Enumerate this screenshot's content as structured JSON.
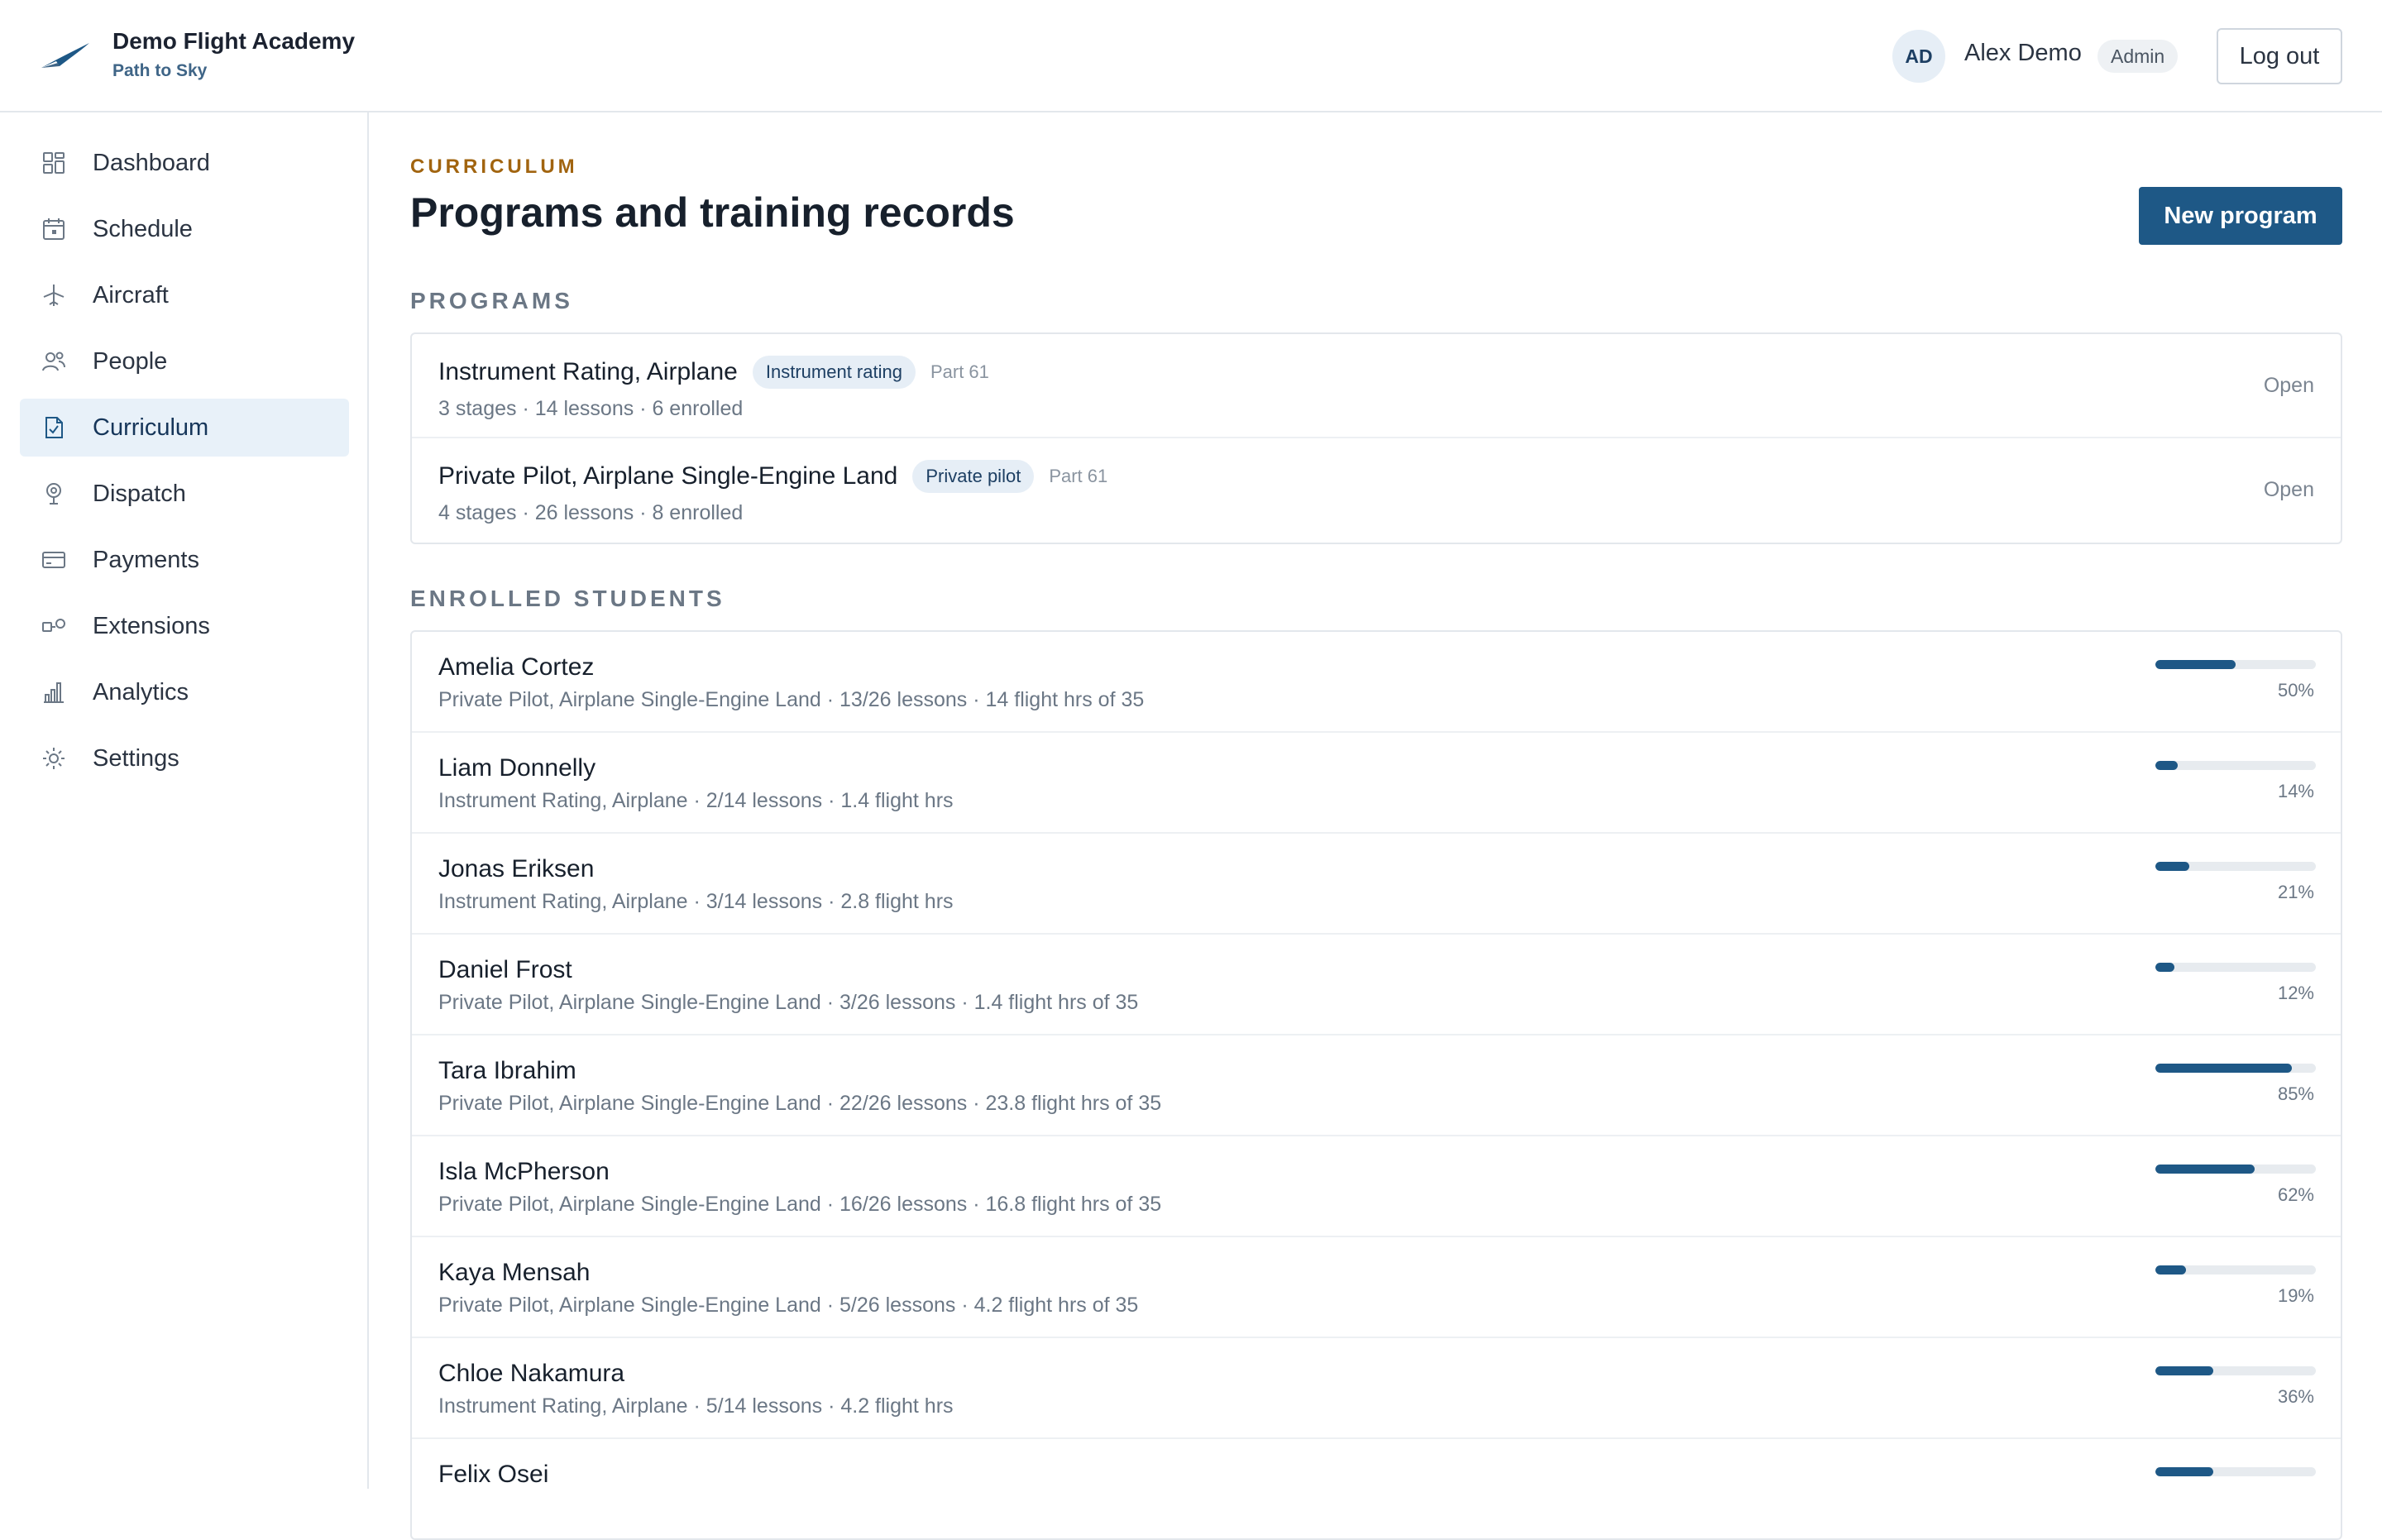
{
  "brand": {
    "name": "Demo Flight Academy",
    "tagline": "Path to Sky"
  },
  "user": {
    "initials": "AD",
    "name": "Alex Demo",
    "role": "Admin",
    "logout_label": "Log out"
  },
  "colors": {
    "accent": "#1e5886",
    "eyebrow": "#a1640f",
    "active_nav_bg": "#e8f1f9"
  },
  "sidebar": {
    "items": [
      {
        "label": "Dashboard",
        "icon": "dashboard-icon",
        "active": false
      },
      {
        "label": "Schedule",
        "icon": "calendar-icon",
        "active": false
      },
      {
        "label": "Aircraft",
        "icon": "airplane-icon",
        "active": false
      },
      {
        "label": "People",
        "icon": "people-icon",
        "active": false
      },
      {
        "label": "Curriculum",
        "icon": "document-check-icon",
        "active": true
      },
      {
        "label": "Dispatch",
        "icon": "location-pin-icon",
        "active": false
      },
      {
        "label": "Payments",
        "icon": "credit-card-icon",
        "active": false
      },
      {
        "label": "Extensions",
        "icon": "extensions-icon",
        "active": false
      },
      {
        "label": "Analytics",
        "icon": "bar-chart-icon",
        "active": false
      },
      {
        "label": "Settings",
        "icon": "gear-icon",
        "active": false
      }
    ]
  },
  "page": {
    "eyebrow": "CURRICULUM",
    "title": "Programs and training records",
    "new_button": "New program"
  },
  "programs": {
    "heading": "PROGRAMS",
    "items": [
      {
        "name": "Instrument Rating, Airplane",
        "badge": "Instrument rating",
        "part": "Part 61",
        "meta": "3 stages · 14 lessons · 6 enrolled",
        "status": "Open"
      },
      {
        "name": "Private Pilot, Airplane Single-Engine Land",
        "badge": "Private pilot",
        "part": "Part 61",
        "meta": "4 stages · 26 lessons · 8 enrolled",
        "status": "Open"
      }
    ]
  },
  "students": {
    "heading": "ENROLLED STUDENTS",
    "items": [
      {
        "name": "Amelia Cortez",
        "meta": "Private Pilot, Airplane Single-Engine Land · 13/26 lessons · 14 flight hrs of 35",
        "progress": 50,
        "progress_label": "50%"
      },
      {
        "name": "Liam Donnelly",
        "meta": "Instrument Rating, Airplane · 2/14 lessons · 1.4 flight hrs",
        "progress": 14,
        "progress_label": "14%"
      },
      {
        "name": "Jonas Eriksen",
        "meta": "Instrument Rating, Airplane · 3/14 lessons · 2.8 flight hrs",
        "progress": 21,
        "progress_label": "21%"
      },
      {
        "name": "Daniel Frost",
        "meta": "Private Pilot, Airplane Single-Engine Land · 3/26 lessons · 1.4 flight hrs of 35",
        "progress": 12,
        "progress_label": "12%"
      },
      {
        "name": "Tara Ibrahim",
        "meta": "Private Pilot, Airplane Single-Engine Land · 22/26 lessons · 23.8 flight hrs of 35",
        "progress": 85,
        "progress_label": "85%"
      },
      {
        "name": "Isla McPherson",
        "meta": "Private Pilot, Airplane Single-Engine Land · 16/26 lessons · 16.8 flight hrs of 35",
        "progress": 62,
        "progress_label": "62%"
      },
      {
        "name": "Kaya Mensah",
        "meta": "Private Pilot, Airplane Single-Engine Land · 5/26 lessons · 4.2 flight hrs of 35",
        "progress": 19,
        "progress_label": "19%"
      },
      {
        "name": "Chloe Nakamura",
        "meta": "Instrument Rating, Airplane · 5/14 lessons · 4.2 flight hrs",
        "progress": 36,
        "progress_label": "36%"
      },
      {
        "name": "Felix Osei",
        "meta": "",
        "progress": 36,
        "progress_label": ""
      }
    ]
  }
}
